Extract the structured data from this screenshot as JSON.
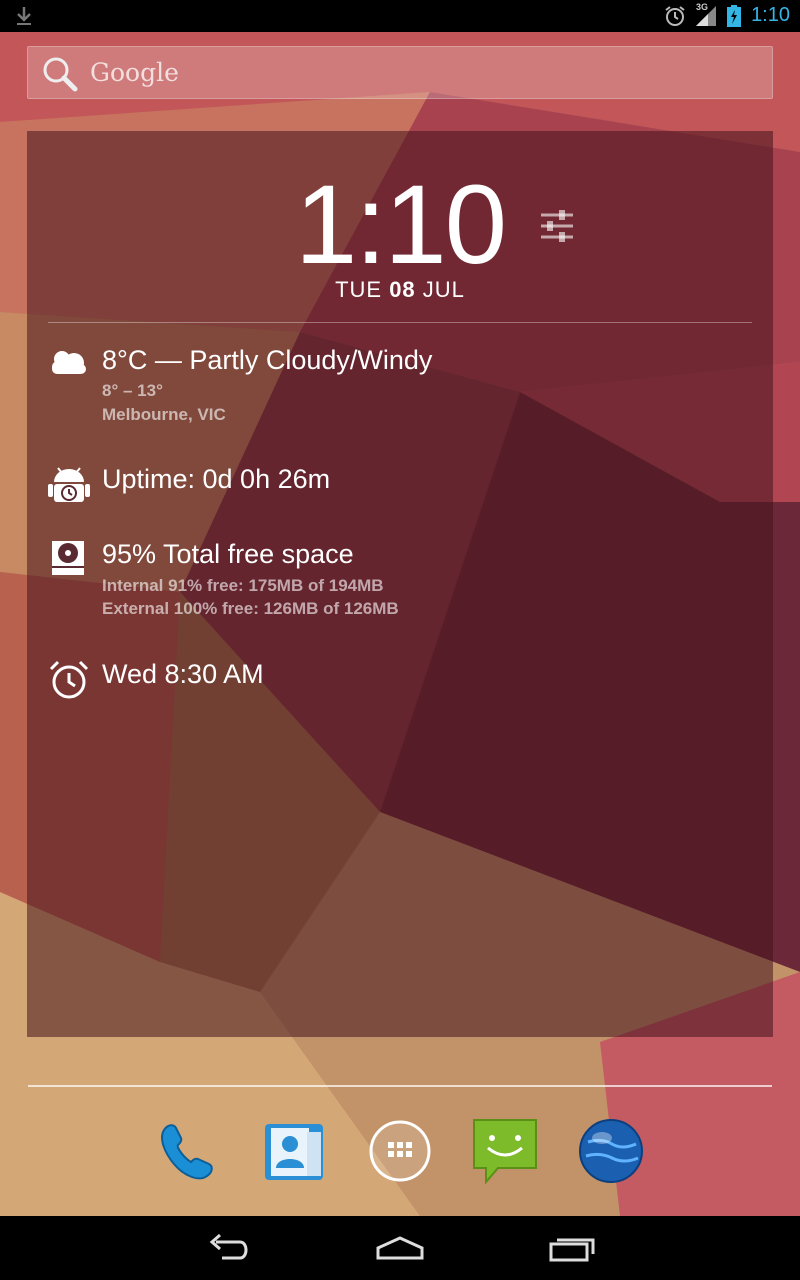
{
  "status_bar": {
    "time": "1:10",
    "network": "3G",
    "icons": [
      "download-icon",
      "alarm-icon",
      "signal-icon",
      "battery-charging-icon"
    ]
  },
  "search": {
    "label": "Google",
    "icon": "search-icon"
  },
  "widget": {
    "clock": {
      "time": "1:10",
      "date_day": "TUE",
      "date_num": "08",
      "date_month": "JUL"
    },
    "weather": {
      "main": "8°C — Partly Cloudy/Windy",
      "range": "8° – 13°",
      "location": "Melbourne, VIC",
      "icon": "cloud-icon"
    },
    "uptime": {
      "main": "Uptime: 0d 0h 26m",
      "icon": "android-uptime-icon"
    },
    "storage": {
      "main": "95% Total free space",
      "internal": "Internal 91% free: 175MB of 194MB",
      "external": "External 100% free: 126MB of 126MB",
      "icon": "storage-icon"
    },
    "alarm": {
      "main": "Wed 8:30 AM",
      "icon": "alarm-clock-icon"
    }
  },
  "dock": {
    "items": [
      "phone-icon",
      "contacts-icon",
      "app-drawer-icon",
      "messaging-icon",
      "browser-globe-icon"
    ]
  },
  "nav_bar": {
    "items": [
      "back-icon",
      "home-icon",
      "recents-icon"
    ]
  },
  "colors": {
    "status_time": "#33b5e5",
    "widget_bg": "rgba(70,20,30,0.55)"
  }
}
